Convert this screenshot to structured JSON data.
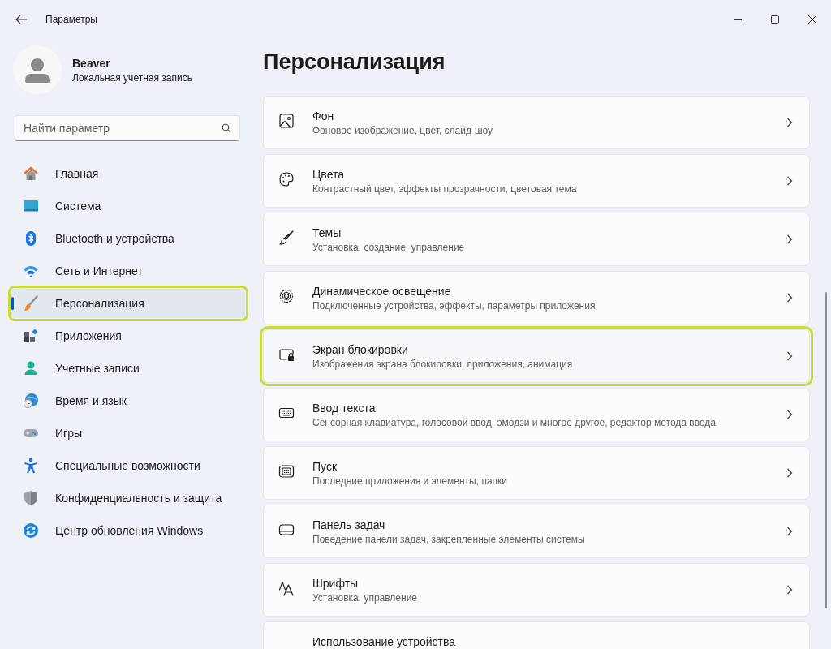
{
  "window": {
    "title": "Параметры"
  },
  "profile": {
    "name": "Beaver",
    "account_type": "Локальная учетная запись"
  },
  "search": {
    "placeholder": "Найти параметр"
  },
  "sidebar": {
    "items": [
      {
        "label": "Главная",
        "selected": false,
        "highlighted": false
      },
      {
        "label": "Система",
        "selected": false,
        "highlighted": false
      },
      {
        "label": "Bluetooth и устройства",
        "selected": false,
        "highlighted": false
      },
      {
        "label": "Сеть и Интернет",
        "selected": false,
        "highlighted": false
      },
      {
        "label": "Персонализация",
        "selected": true,
        "highlighted": true
      },
      {
        "label": "Приложения",
        "selected": false,
        "highlighted": false
      },
      {
        "label": "Учетные записи",
        "selected": false,
        "highlighted": false
      },
      {
        "label": "Время и язык",
        "selected": false,
        "highlighted": false
      },
      {
        "label": "Игры",
        "selected": false,
        "highlighted": false
      },
      {
        "label": "Специальные возможности",
        "selected": false,
        "highlighted": false
      },
      {
        "label": "Конфиденциальность и защита",
        "selected": false,
        "highlighted": false
      },
      {
        "label": "Центр обновления Windows",
        "selected": false,
        "highlighted": false
      }
    ]
  },
  "page": {
    "title": "Персонализация"
  },
  "cards": [
    {
      "title": "Фон",
      "subtitle": "Фоновое изображение, цвет, слайд-шоу",
      "highlighted": false
    },
    {
      "title": "Цвета",
      "subtitle": "Контрастный цвет, эффекты прозрачности, цветовая тема",
      "highlighted": false
    },
    {
      "title": "Темы",
      "subtitle": "Установка, создание, управление",
      "highlighted": false
    },
    {
      "title": "Динамическое освещение",
      "subtitle": "Подключенные устройства, эффекты, параметры приложения",
      "highlighted": false
    },
    {
      "title": "Экран блокировки",
      "subtitle": "Изображения экрана блокировки, приложения, анимация",
      "highlighted": true
    },
    {
      "title": "Ввод текста",
      "subtitle": "Сенсорная клавиатура, голосовой ввод, эмодзи и многое другое, редактор метода ввода",
      "highlighted": false
    },
    {
      "title": "Пуск",
      "subtitle": "Последние приложения и элементы, папки",
      "highlighted": false
    },
    {
      "title": "Панель задач",
      "subtitle": "Поведение панели задач, закрепленные элементы системы",
      "highlighted": false
    },
    {
      "title": "Шрифты",
      "subtitle": "Установка, управление",
      "highlighted": false
    },
    {
      "title": "Использование устройства",
      "highlighted": false
    }
  ]
}
